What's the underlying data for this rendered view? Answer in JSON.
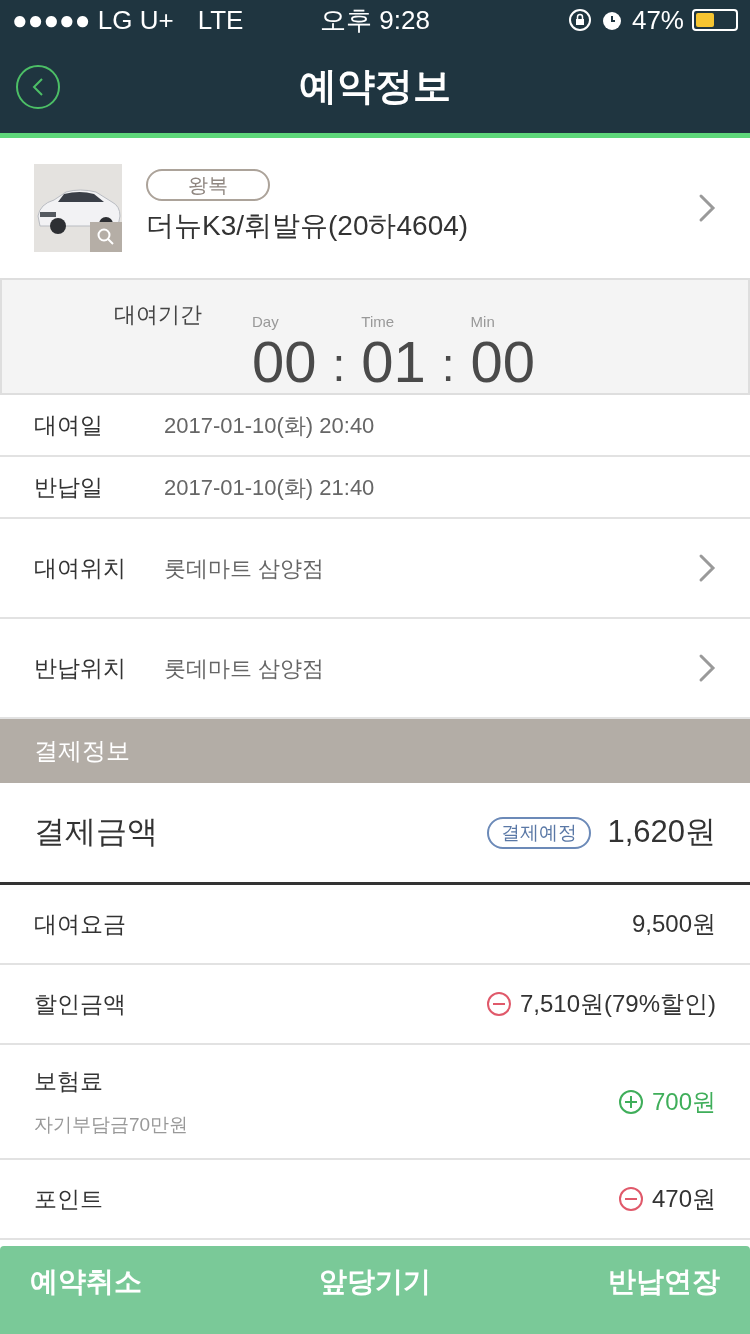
{
  "status_bar": {
    "carrier": "●●●●● LG U+",
    "network": "LTE",
    "time": "오후 9:28",
    "battery": "47%"
  },
  "header": {
    "title": "예약정보"
  },
  "vehicle": {
    "trip_type": "왕복",
    "name": "더뉴K3/휘발유(20하4604)"
  },
  "rental_period": {
    "label": "대여기간",
    "units": [
      {
        "label": "Day",
        "value": "00"
      },
      {
        "label": "Time",
        "value": "01"
      },
      {
        "label": "Min",
        "value": "00"
      }
    ],
    "separators": [
      ":",
      ":"
    ]
  },
  "details": [
    {
      "label": "대여일",
      "value": "2017-01-10(화) 20:40",
      "has_chevron": false
    },
    {
      "label": "반납일",
      "value": "2017-01-10(화) 21:40",
      "has_chevron": false
    },
    {
      "label": "대여위치",
      "value": "롯데마트 삼양점",
      "has_chevron": true
    },
    {
      "label": "반납위치",
      "value": "롯데마트 삼양점",
      "has_chevron": true
    }
  ],
  "payment": {
    "section_title": "결제정보",
    "total": {
      "label": "결제금액",
      "badge": "결제예정",
      "amount": "1,620원"
    },
    "items": [
      {
        "kind": "plain",
        "label": "대여요금",
        "amount": "9,500원"
      },
      {
        "kind": "minus",
        "label": "할인금액",
        "amount": "7,510원(79%할인)"
      },
      {
        "kind": "plus",
        "label": "보험료",
        "sub": "자기부담금70만원",
        "amount": "700원"
      },
      {
        "kind": "minus",
        "label": "포인트",
        "amount": "470원"
      }
    ]
  },
  "actions": [
    "예약취소",
    "앞당기기",
    "반납연장"
  ]
}
